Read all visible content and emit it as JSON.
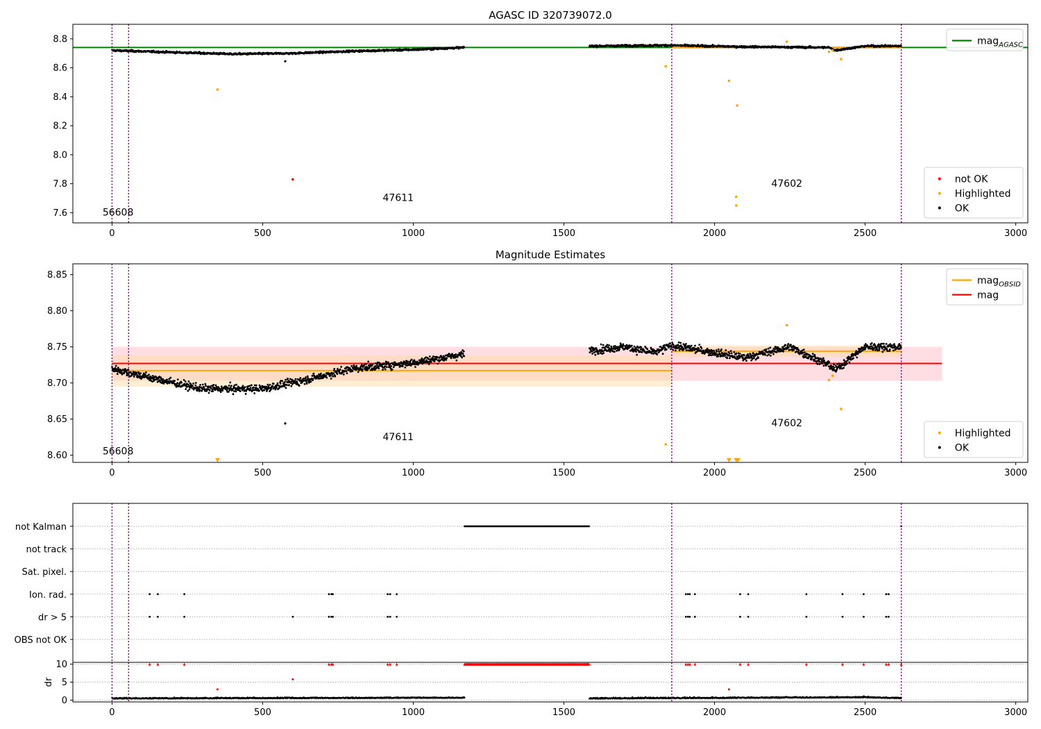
{
  "chart_data": [
    {
      "id": "top",
      "type": "scatter",
      "title": "AGASC ID 320739072.0",
      "xlim": [
        -130,
        3040
      ],
      "ylim": [
        7.53,
        8.9
      ],
      "xticks": [
        0,
        500,
        1000,
        1500,
        2000,
        2500,
        3000
      ],
      "yticks": [
        7.6,
        7.8,
        8.0,
        8.2,
        8.4,
        8.6,
        8.8
      ],
      "ytick_labels": [
        "7.6",
        "7.8",
        "8.0",
        "8.2",
        "8.4",
        "8.6",
        "8.8"
      ],
      "grid": false,
      "obsid_boundaries": [
        0,
        55,
        1858,
        2620
      ],
      "obsid_labels": [
        {
          "text": "56608",
          "x": 20,
          "y": 7.58
        },
        {
          "text": "47611",
          "x": 950,
          "y": 7.68
        },
        {
          "text": "47602",
          "x": 2240,
          "y": 7.78
        }
      ],
      "hlines": [
        {
          "name": "mag_AGASC",
          "y": 8.74,
          "x": [
            -130,
            3040
          ],
          "color": "#008000"
        }
      ],
      "segments": [
        {
          "x": [
            1858,
            2620
          ],
          "y": [
            8.74,
            8.74
          ],
          "color": "#ffa500"
        }
      ],
      "ok_series": {
        "name": "OK",
        "color": "#000000",
        "ranges": [
          {
            "x": [
              0,
              1170
            ],
            "trend": [
              [
                0,
                8.72
              ],
              [
                150,
                8.71
              ],
              [
                400,
                8.695
              ],
              [
                600,
                8.7
              ],
              [
                800,
                8.715
              ],
              [
                1000,
                8.725
              ],
              [
                1170,
                8.74
              ]
            ],
            "noise": 0.01
          },
          {
            "x": [
              1585,
              2620
            ],
            "trend": [
              [
                1585,
                8.75
              ],
              [
                1850,
                8.755
              ],
              [
                2100,
                8.745
              ],
              [
                2380,
                8.74
              ],
              [
                2400,
                8.72
              ],
              [
                2500,
                8.75
              ],
              [
                2620,
                8.75
              ]
            ],
            "noise": 0.01
          }
        ],
        "extra_points": [
          [
            575,
            8.645
          ]
        ]
      },
      "highlighted_series": {
        "name": "Highlighted",
        "color": "#ffa500",
        "points": [
          [
            350,
            8.45
          ],
          [
            1838,
            8.61
          ],
          [
            2048,
            8.51
          ],
          [
            2075,
            8.34
          ],
          [
            2072,
            7.71
          ],
          [
            2072,
            7.65
          ],
          [
            2420,
            8.66
          ],
          [
            2380,
            8.71
          ],
          [
            2392,
            8.72
          ],
          [
            2240,
            8.78
          ]
        ]
      },
      "notok_series": {
        "name": "not OK",
        "color": "#ff0000",
        "points": [
          [
            600,
            7.83
          ]
        ]
      },
      "legends": [
        {
          "position": "top-right",
          "entries": [
            {
              "kind": "line",
              "color": "#008000",
              "label": "mag",
              "sub": "AGASC"
            }
          ]
        },
        {
          "position": "bottom-right",
          "entries": [
            {
              "kind": "dot",
              "color": "#ff0000",
              "label": "not OK"
            },
            {
              "kind": "dot",
              "color": "#ffa500",
              "label": "Highlighted"
            },
            {
              "kind": "dot",
              "color": "#000000",
              "label": "OK"
            }
          ]
        }
      ]
    },
    {
      "id": "mid",
      "type": "scatter",
      "title": "Magnitude Estimates",
      "xlim": [
        -130,
        3040
      ],
      "ylim": [
        8.59,
        8.865
      ],
      "xticks": [
        0,
        500,
        1000,
        1500,
        2000,
        2500,
        3000
      ],
      "yticks": [
        8.6,
        8.65,
        8.7,
        8.75,
        8.8,
        8.85
      ],
      "ytick_labels": [
        "8.60",
        "8.65",
        "8.70",
        "8.75",
        "8.80",
        "8.85"
      ],
      "grid": false,
      "obsid_boundaries": [
        0,
        55,
        1858,
        2620
      ],
      "obsid_labels": [
        {
          "text": "56608",
          "x": 20,
          "y": 8.601
        },
        {
          "text": "47611",
          "x": 950,
          "y": 8.621
        },
        {
          "text": "47602",
          "x": 2240,
          "y": 8.64
        }
      ],
      "bands": [
        {
          "x": [
            0,
            2755
          ],
          "y": [
            8.703,
            8.75
          ],
          "color": "#ffb6c1",
          "opacity": 0.45
        },
        {
          "x": [
            0,
            1858
          ],
          "y": [
            8.695,
            8.738
          ],
          "color": "#ffd9a0",
          "opacity": 0.45
        },
        {
          "x": [
            1858,
            2620
          ],
          "y": [
            8.736,
            8.752
          ],
          "color": "#ffd9a0",
          "opacity": 0.45
        }
      ],
      "segments": [
        {
          "x": [
            0,
            1858
          ],
          "y": [
            8.717,
            8.717
          ],
          "color": "#ffa500",
          "name": "mag_OBSID"
        },
        {
          "x": [
            1858,
            2620
          ],
          "y": [
            8.744,
            8.744
          ],
          "color": "#ffa500"
        },
        {
          "x": [
            0,
            2755
          ],
          "y": [
            8.727,
            8.727
          ],
          "color": "#ff0000",
          "name": "mag"
        }
      ],
      "ok_series": {
        "name": "OK",
        "color": "#000000",
        "ranges": [
          {
            "x": [
              0,
              1170
            ],
            "trend": [
              [
                0,
                8.72
              ],
              [
                150,
                8.705
              ],
              [
                300,
                8.692
              ],
              [
                500,
                8.692
              ],
              [
                650,
                8.705
              ],
              [
                800,
                8.72
              ],
              [
                1000,
                8.728
              ],
              [
                1170,
                8.74
              ]
            ],
            "noise": 0.009
          },
          {
            "x": [
              1585,
              2620
            ],
            "trend": [
              [
                1585,
                8.745
              ],
              [
                1700,
                8.75
              ],
              [
                1800,
                8.742
              ],
              [
                1858,
                8.752
              ],
              [
                2000,
                8.742
              ],
              [
                2100,
                8.735
              ],
              [
                2250,
                8.75
              ],
              [
                2380,
                8.725
              ],
              [
                2400,
                8.718
              ],
              [
                2500,
                8.75
              ],
              [
                2620,
                8.75
              ]
            ],
            "noise": 0.009
          }
        ],
        "extra_points": [
          [
            575,
            8.644
          ]
        ]
      },
      "highlighted_series": {
        "name": "Highlighted",
        "color": "#ffa500",
        "points": [
          [
            1838,
            8.615
          ],
          [
            2420,
            8.664
          ],
          [
            2380,
            8.704
          ],
          [
            2392,
            8.71
          ],
          [
            2240,
            8.78
          ]
        ]
      },
      "offscale_markers": {
        "color": "#ffa500",
        "x": [
          350,
          2048,
          2072,
          2078
        ],
        "y": 8.593
      },
      "legends": [
        {
          "position": "top-right",
          "entries": [
            {
              "kind": "line",
              "color": "#ffa500",
              "label": "mag",
              "sub": "OBSID"
            },
            {
              "kind": "line",
              "color": "#ff0000",
              "label": "mag"
            }
          ]
        },
        {
          "position": "bottom-right",
          "entries": [
            {
              "kind": "dot",
              "color": "#ffa500",
              "label": "Highlighted"
            },
            {
              "kind": "dot",
              "color": "#000000",
              "label": "OK"
            }
          ]
        }
      ]
    },
    {
      "id": "flags",
      "type": "scatter",
      "xlim": [
        -130,
        3040
      ],
      "grid": "horizontal dotted",
      "categories": [
        "not Kalman",
        "not track",
        "Sat. pixel.",
        "Ion. rad.",
        "dr > 5",
        "OBS not OK"
      ],
      "obsid_boundaries": [
        0,
        55,
        1858,
        2620
      ],
      "flag_points": {
        "not Kalman": {
          "ranges": [
            [
              1170,
              1585
            ]
          ],
          "points": [
            2620
          ]
        },
        "not track": {
          "points": []
        },
        "Sat. pixel.": {
          "points": []
        },
        "Ion. rad.": {
          "points": [
            125,
            152,
            240,
            720,
            728,
            733,
            915,
            923,
            945,
            1905,
            1912,
            1918,
            1935,
            2085,
            2112,
            2305,
            2425,
            2495,
            2570,
            2578
          ]
        },
        "dr > 5": {
          "points": [
            125,
            152,
            240,
            600,
            720,
            728,
            733,
            915,
            923,
            945,
            1905,
            1912,
            1918,
            1935,
            2085,
            2112,
            2305,
            2425,
            2495,
            2570,
            2578
          ]
        },
        "OBS not OK": {
          "points": []
        }
      }
    },
    {
      "id": "dr",
      "type": "scatter",
      "xlim": [
        -130,
        3040
      ],
      "xticks": [
        0,
        500,
        1000,
        1500,
        2000,
        2500,
        3000
      ],
      "ylim": [
        -0.5,
        10.5
      ],
      "yticks": [
        0,
        5,
        10
      ],
      "ytick_labels": [
        "0",
        "5",
        "10"
      ],
      "ylabel": "dr",
      "obsid_boundaries": [
        0,
        55,
        1858,
        2620
      ],
      "ok_series": {
        "color": "#000000",
        "ranges": [
          {
            "x": [
              0,
              1170
            ],
            "trend": [
              [
                0,
                0.4
              ],
              [
                1170,
                0.6
              ]
            ],
            "noise": 0.35
          },
          {
            "x": [
              1585,
              2620
            ],
            "trend": [
              [
                1585,
                0.4
              ],
              [
                2500,
                0.7
              ],
              [
                2620,
                0.5
              ]
            ],
            "noise": 0.4
          }
        ]
      },
      "red_at_cap": {
        "color": "#ff0000",
        "y": 10,
        "ranges": [
          [
            1170,
            1585
          ]
        ],
        "points": [
          125,
          152,
          240,
          720,
          728,
          733,
          915,
          923,
          945,
          1905,
          1912,
          1918,
          1935,
          2085,
          2112,
          2305,
          2425,
          2495,
          2570,
          2578,
          2620
        ]
      },
      "red_points": [
        [
          600,
          5.8
        ],
        [
          350,
          3.0
        ],
        [
          2048,
          3.0
        ]
      ]
    }
  ]
}
